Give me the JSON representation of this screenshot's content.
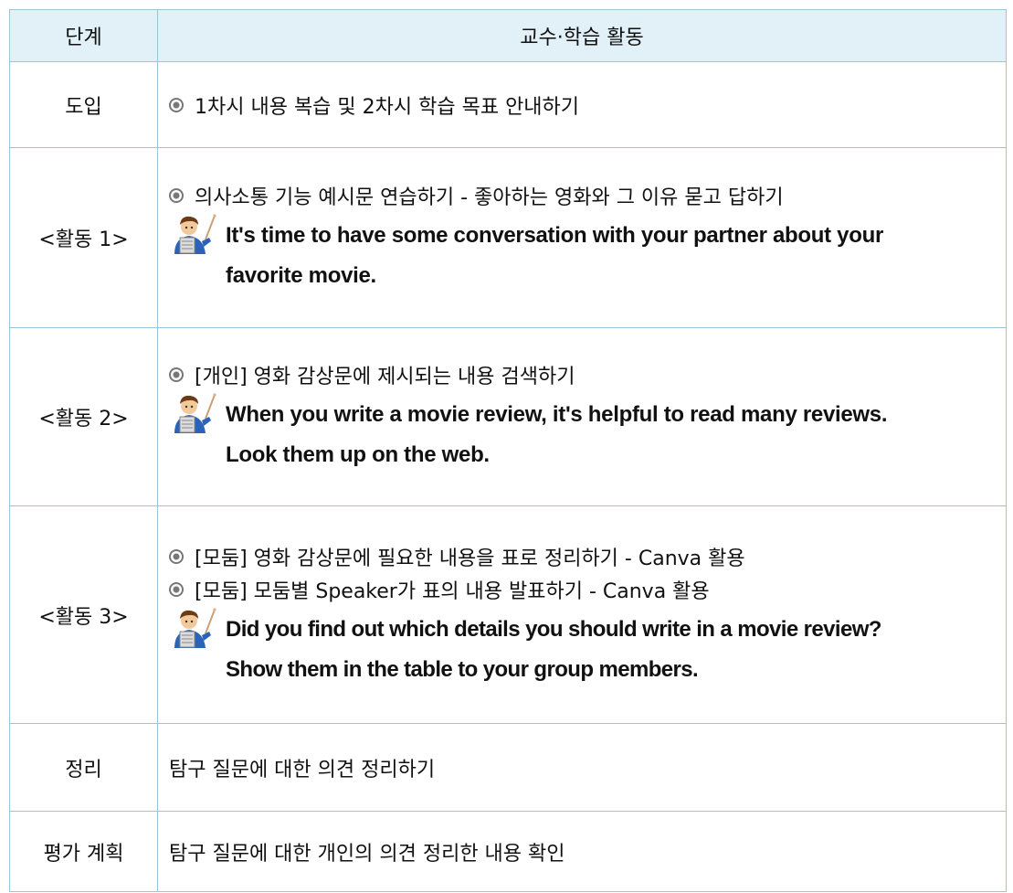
{
  "header": {
    "stage": "단계",
    "activity": "교수·학습 활동"
  },
  "rows": [
    {
      "stage": "도입",
      "bullets": [
        "1차시 내용 복습 및 2차시 학습 목표 안내하기"
      ]
    },
    {
      "stage": "<활동 1>",
      "bullets": [
        "의사소통 기능 예시문 연습하기 - 좋아하는 영화와 그 이유 묻고 답하기"
      ],
      "teacher_lines": [
        "It's time to have some conversation with your partner about your",
        "favorite movie."
      ]
    },
    {
      "stage": "<활동 2>",
      "bullets": [
        "[개인] 영화 감상문에 제시되는 내용 검색하기"
      ],
      "teacher_lines": [
        "When you write a movie review, it's helpful to read many reviews.",
        "Look them up on the web."
      ]
    },
    {
      "stage": "<활동 3>",
      "bullets": [
        "[모둠] 영화 감상문에 필요한 내용을 표로 정리하기 - Canva 활용",
        "[모둠] 모둠별 Speaker가 표의 내용 발표하기 - Canva 활용"
      ],
      "teacher_lines": [
        "Did you find out which details you should write in a movie review?",
        "Show them in the table to your group members."
      ]
    },
    {
      "stage": "정리",
      "text": "탐구 질문에 대한 의견 정리하기"
    },
    {
      "stage": "평가 계획",
      "text": "탐구 질문에 대한 개인의 의견 정리한 내용 확인"
    }
  ],
  "icons": {
    "bullet": "circle-bullet-icon",
    "teacher": "teacher-pointer-icon"
  },
  "colors": {
    "border": "#9ec4d6",
    "header_bg": "#e2f1f8"
  }
}
